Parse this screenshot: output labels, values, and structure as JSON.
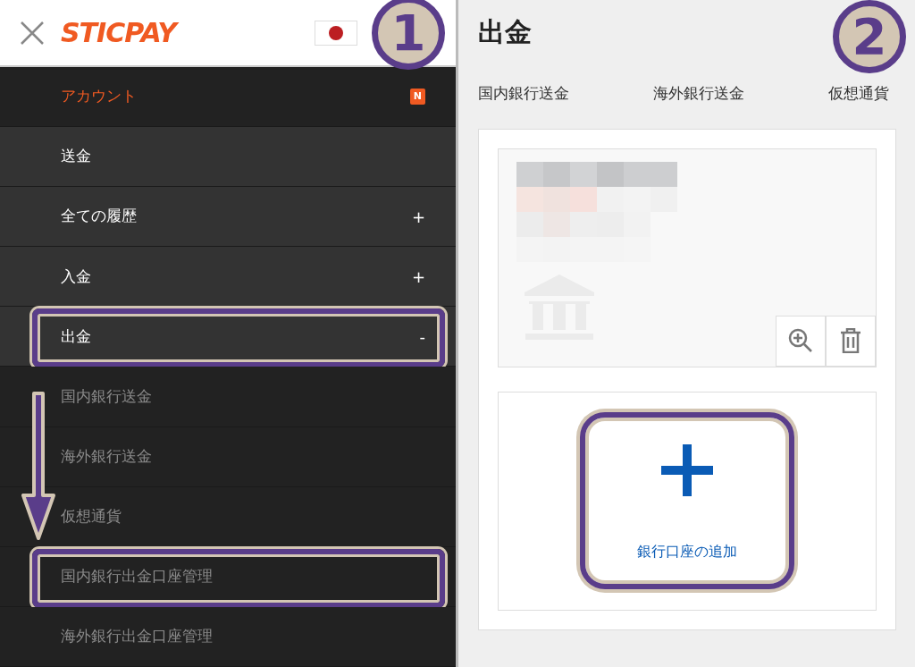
{
  "menu_header": {
    "logo": "STICPAY"
  },
  "menu": [
    {
      "label": "アカウント",
      "kind": "top",
      "selected": true,
      "badge": "N",
      "highlighted": false
    },
    {
      "label": "送金",
      "kind": "top",
      "selected": false,
      "highlighted": false
    },
    {
      "label": "全ての履歴",
      "kind": "top",
      "selected": false,
      "toggle": "+",
      "highlighted": false
    },
    {
      "label": "入金",
      "kind": "top",
      "selected": false,
      "toggle": "+",
      "highlighted": false
    },
    {
      "label": "出金",
      "kind": "top",
      "selected": false,
      "toggle": "-",
      "highlighted": true
    },
    {
      "label": "国内銀行送金",
      "kind": "sub",
      "selected": false,
      "highlighted": false
    },
    {
      "label": "海外銀行送金",
      "kind": "sub",
      "selected": false,
      "highlighted": false
    },
    {
      "label": "仮想通貨",
      "kind": "sub",
      "selected": false,
      "highlighted": false
    },
    {
      "label": "国内銀行出金口座管理",
      "kind": "sub",
      "selected": false,
      "highlighted": true
    },
    {
      "label": "海外銀行出金口座管理",
      "kind": "sub",
      "selected": false,
      "highlighted": false
    }
  ],
  "page": {
    "title": "出金",
    "tabs": [
      {
        "label": "国内銀行送金",
        "selected": false
      },
      {
        "label": "海外銀行送金",
        "selected": false
      },
      {
        "label": "仮想通貨",
        "selected": false
      }
    ],
    "add_account": {
      "label": "銀行口座の追加",
      "highlighted": true
    }
  },
  "step_markers": [
    "1",
    "2"
  ]
}
